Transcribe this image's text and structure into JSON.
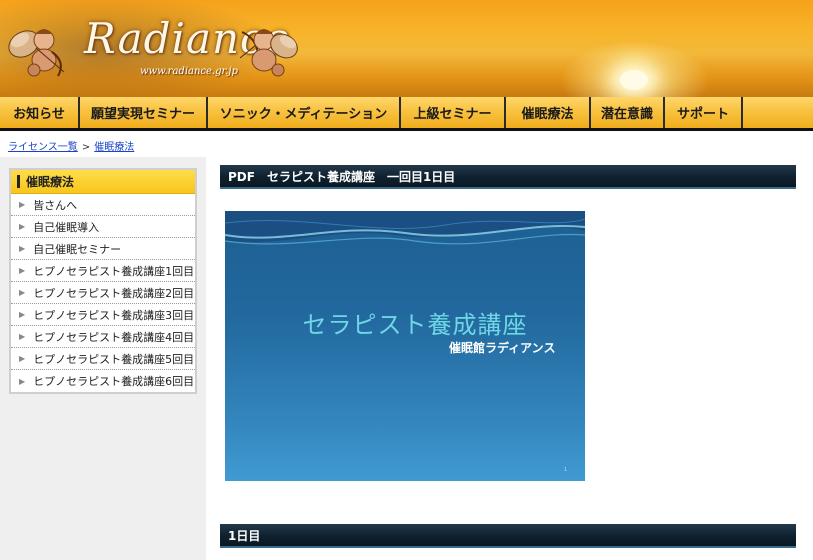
{
  "header": {
    "logo_text": "Radiance",
    "logo_url": "www.radiance.gr.jp"
  },
  "nav": {
    "items": [
      {
        "label": "お知らせ"
      },
      {
        "label": "願望実現セミナー"
      },
      {
        "label": "ソニック・メディテーション"
      },
      {
        "label": "上級セミナー"
      },
      {
        "label": "催眠療法"
      },
      {
        "label": "潜在意識"
      },
      {
        "label": "サポート"
      }
    ]
  },
  "breadcrumb": {
    "items": [
      "ライセンス一覧",
      "催眠療法"
    ],
    "separator": ">"
  },
  "sidebar": {
    "title": "催眠療法",
    "items": [
      {
        "label": "皆さんへ"
      },
      {
        "label": "自己催眠導入"
      },
      {
        "label": "自己催眠セミナー"
      },
      {
        "label": "ヒプノセラピスト養成講座1回目"
      },
      {
        "label": "ヒプノセラピスト養成講座2回目"
      },
      {
        "label": "ヒプノセラピスト養成講座3回目"
      },
      {
        "label": "ヒプノセラピスト養成講座4回目"
      },
      {
        "label": "ヒプノセラピスト養成講座5回目"
      },
      {
        "label": "ヒプノセラピスト養成講座6回目"
      }
    ]
  },
  "main": {
    "section1_title": "PDF　セラピスト養成講座　一回目1日目",
    "slide": {
      "title": "セラピスト養成講座",
      "subtitle": "催眠館ラディアンス",
      "page_number": "1"
    },
    "section2_title": "1日目"
  },
  "colors": {
    "header_gold": "#f6a21a",
    "nav_yellow": "#f8c240",
    "section_navy": "#0f2130",
    "slide_blue": "#22699f",
    "slide_title_cyan": "#6fd6e6",
    "link_blue": "#1a44c8"
  },
  "icons": {
    "cherub_left": "cherub-icon",
    "cherub_right": "cherub-icon",
    "side_arrow": "triangle-right-icon"
  }
}
